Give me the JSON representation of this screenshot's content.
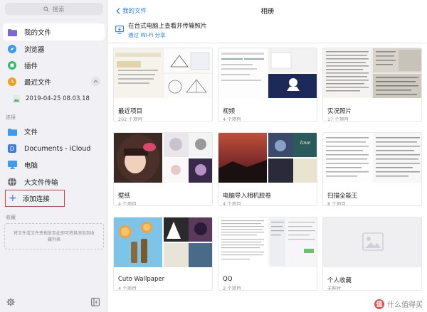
{
  "sidebar": {
    "search_placeholder": "搜索",
    "items": [
      {
        "label": "我的文件",
        "icon": "folder-icon"
      },
      {
        "label": "浏览器",
        "icon": "compass-icon"
      },
      {
        "label": "插件",
        "icon": "puzzle-icon"
      },
      {
        "label": "最近文件",
        "icon": "clock-icon"
      }
    ],
    "recent_sub": {
      "label": "2019-04-25 08.03.18",
      "icon": "image-icon"
    },
    "connections_header": "连接",
    "connections": [
      {
        "label": "文件",
        "icon": "folder-icon"
      },
      {
        "label": "Documents - iCloud",
        "icon": "documents-icon"
      },
      {
        "label": "电脑",
        "icon": "monitor-icon"
      },
      {
        "label": "大文件传输",
        "icon": "globe-icon"
      }
    ],
    "add_connection": "添加连接",
    "favorites_header": "收藏",
    "favorites_hint": "将文件或文件夹拖放至此即可将其添加到收藏列表"
  },
  "header": {
    "back_label": "我的文件",
    "title": "相册"
  },
  "wifi": {
    "title": "在台式电脑上查看并传输照片",
    "subtitle": "通过 Wi-Fi 分享"
  },
  "albums": [
    {
      "name": "最近项目",
      "count": "202 个项目"
    },
    {
      "name": "视频",
      "count": "4 个项目"
    },
    {
      "name": "实况照片",
      "count": "17 个项目"
    },
    {
      "name": "壁纸",
      "count": "4 个项目"
    },
    {
      "name": "电脑导入相机胶卷",
      "count": "4 个项目"
    },
    {
      "name": "扫描全能王",
      "count": "8 个项目"
    },
    {
      "name": "Cuto Wallpaper",
      "count": "4 个项目"
    },
    {
      "name": "QQ",
      "count": "2 个项目"
    },
    {
      "name": "个人收藏",
      "count": "无照片"
    }
  ],
  "watermark": {
    "badge": "值",
    "text": "什么值得买"
  },
  "colors": {
    "accent": "#2a7cf6",
    "sidebar_bg": "#f1f0f5",
    "highlight_border": "#e04040"
  }
}
